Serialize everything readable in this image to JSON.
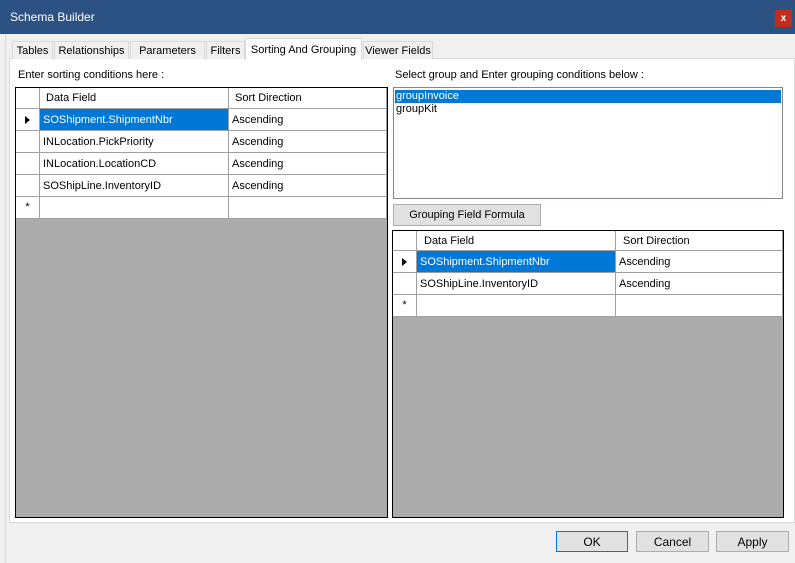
{
  "window": {
    "title": "Schema Builder",
    "close_glyph": "x"
  },
  "tabs": [
    {
      "label": "Tables",
      "active": false
    },
    {
      "label": "Relationships",
      "active": false
    },
    {
      "label": "Parameters",
      "active": false
    },
    {
      "label": "Filters",
      "active": false
    },
    {
      "label": "Sorting And Grouping",
      "active": true
    },
    {
      "label": "Viewer Fields",
      "active": false
    }
  ],
  "sorting": {
    "label": "Enter sorting conditions here :",
    "columns": [
      "Data Field",
      "Sort Direction"
    ],
    "rows": [
      {
        "field": "SOShipment.ShipmentNbr",
        "direction": "Ascending"
      },
      {
        "field": "INLocation.PickPriority",
        "direction": "Ascending"
      },
      {
        "field": "INLocation.LocationCD",
        "direction": "Ascending"
      },
      {
        "field": "SOShipLine.InventoryID",
        "direction": "Ascending"
      }
    ],
    "new_row_glyph": "*"
  },
  "grouping": {
    "label": "Select group and Enter grouping conditions below :",
    "groups": [
      "groupInvoice",
      "groupKit"
    ],
    "selected_group": "groupInvoice",
    "formula_button": "Grouping Field Formula",
    "columns": [
      "Data Field",
      "Sort Direction"
    ],
    "rows": [
      {
        "field": "SOShipment.ShipmentNbr",
        "direction": "Ascending"
      },
      {
        "field": "SOShipLine.InventoryID",
        "direction": "Ascending"
      }
    ],
    "new_row_glyph": "*"
  },
  "footer": {
    "ok": "OK",
    "cancel": "Cancel",
    "apply": "Apply"
  },
  "colors": {
    "titlebar": "#2b5282",
    "selection": "#0078d7",
    "grid_background": "#ababab",
    "close_button": "#c42b1c"
  }
}
